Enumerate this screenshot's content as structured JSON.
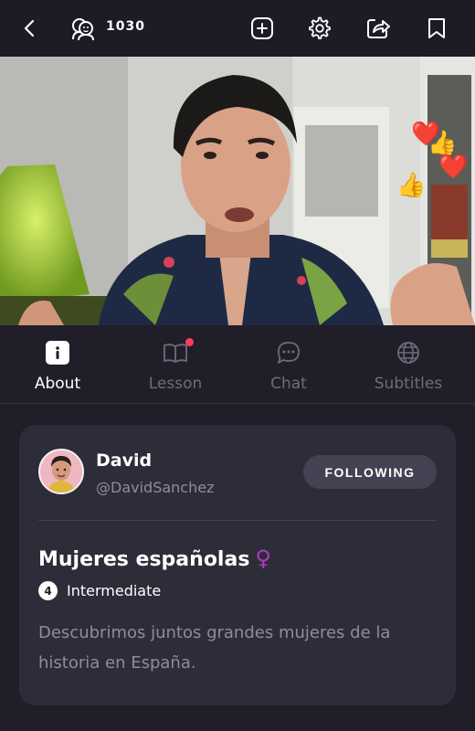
{
  "header": {
    "back_icon": "chevron-left-icon",
    "viewers_icon": "viewers-icon",
    "viewer_count": "1030",
    "actions": [
      {
        "icon": "add-square-icon"
      },
      {
        "icon": "gear-icon"
      },
      {
        "icon": "share-icon"
      },
      {
        "icon": "bookmark-icon"
      }
    ]
  },
  "video": {
    "reactions": [
      "❤️",
      "👍",
      "❤️",
      "👍"
    ]
  },
  "tabs": [
    {
      "label": "About",
      "icon": "info-icon",
      "active": true
    },
    {
      "label": "Lesson",
      "icon": "book-icon",
      "has_notification": true
    },
    {
      "label": "Chat",
      "icon": "chat-bubble-icon"
    },
    {
      "label": "Subtitles",
      "icon": "globe-icon"
    }
  ],
  "author": {
    "name": "David",
    "handle": "@DavidSanchez",
    "follow_label": "FOLLOWING"
  },
  "lesson": {
    "title": "Mujeres españolas",
    "title_emoji": "♀",
    "level_number": "4",
    "level_label": "Intermediate",
    "description": "Descubrimos juntos grandes mujeres de la historia en España."
  },
  "colors": {
    "background": "#1f1e29",
    "card": "#2d2c39",
    "notification": "#ff3d5a",
    "accent_purple": "#b036c9"
  }
}
